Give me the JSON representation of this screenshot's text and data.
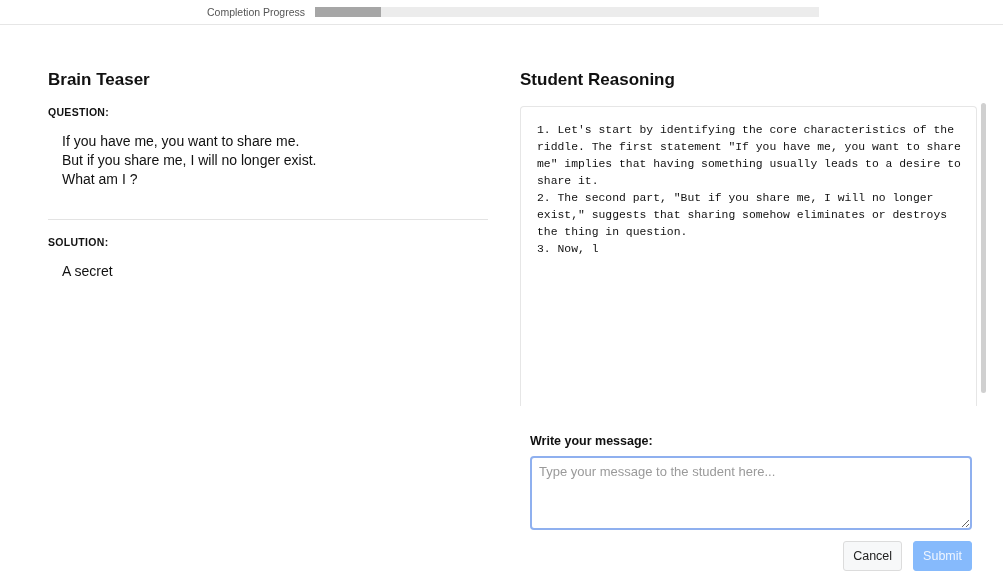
{
  "progress": {
    "label": "Completion Progress",
    "level": 0.13
  },
  "teaser": {
    "title": "Brain Teaser",
    "question_label": "QUESTION:",
    "question_lines": [
      "If you have me, you want to share me.",
      "But if you share me, I will no longer exist.",
      "What am I ?"
    ],
    "solution_label": "SOLUTION:",
    "solution": "A secret"
  },
  "reasoning": {
    "title": "Student Reasoning",
    "text": "1. Let's start by identifying the core characteristics of the riddle. The first statement \"If you have me, you want to share me\" implies that having something usually leads to a desire to share it.\n2. The second part, \"But if you share me, I will no longer exist,\" suggests that sharing somehow eliminates or destroys the thing in question.\n3. Now, l"
  },
  "message": {
    "label": "Write your message:",
    "placeholder": "Type your message to the student here..."
  },
  "buttons": [
    {
      "label": "Cancel",
      "kind": "secondary",
      "disabled": false
    },
    {
      "label": "Submit",
      "kind": "primary",
      "disabled": true
    }
  ]
}
